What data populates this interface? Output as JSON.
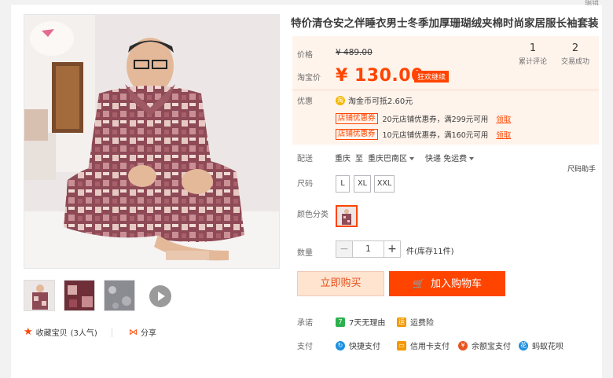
{
  "top": {
    "edit_label": "编辑"
  },
  "product": {
    "title": "特价清仓安之伴睡衣男士冬季加厚珊瑚绒夹棉时尚家居服长袖套装"
  },
  "price": {
    "orig_label": "价格",
    "orig_value": "¥ 489.00",
    "promo_label": "淘宝价",
    "promo_value": "¥ 130.00",
    "promo_tag": "狂欢继续"
  },
  "stats": [
    {
      "number": "1",
      "label": "累计评论"
    },
    {
      "number": "2",
      "label": "交易成功"
    }
  ],
  "promo": {
    "label": "优惠",
    "coin_text": "淘金币可抵2.60元",
    "coupons": [
      {
        "tag": "店铺优惠券",
        "text": "20元店铺优惠券，满299元可用",
        "action": "领取"
      },
      {
        "tag": "店铺优惠券",
        "text": "10元店铺优惠券，满160元可用",
        "action": "领取"
      }
    ]
  },
  "shipping": {
    "label": "配送",
    "from": "重庆",
    "to_word": "至",
    "to": "重庆巴南区",
    "method": "快递 免运费"
  },
  "size": {
    "label": "尺码",
    "helper": "尺码助手",
    "options": [
      "L",
      "XL",
      "XXL"
    ]
  },
  "color": {
    "label": "颜色分类"
  },
  "quantity": {
    "label": "数量",
    "value": "1",
    "minus": "−",
    "plus": "+",
    "stock": "件(库存11件)"
  },
  "actions": {
    "buy_now": "立即购买",
    "add_to_cart": "加入购物车"
  },
  "promise": {
    "label": "承诺",
    "items": [
      {
        "icon": "seven-days-icon",
        "glyph": "7",
        "text": "7天无理由",
        "color": "#2db14e"
      },
      {
        "icon": "shipping-insurance-icon",
        "glyph": "运",
        "text": "运费险",
        "color": "#f39800"
      }
    ]
  },
  "payment": {
    "label": "支付",
    "items": [
      {
        "icon": "quick-pay-icon",
        "glyph": "↻",
        "text": "快捷支付",
        "color": "#1d8fe1"
      },
      {
        "icon": "credit-card-icon",
        "glyph": "▭",
        "text": "信用卡支付",
        "color": "#f39800"
      },
      {
        "icon": "yuebao-icon",
        "glyph": "¥",
        "text": "余额宝支付",
        "color": "#e8541e"
      },
      {
        "icon": "huabei-icon",
        "glyph": "花",
        "text": "蚂蚁花呗",
        "color": "#1d8fe1"
      }
    ]
  },
  "gallery": {
    "favorite": "收藏宝贝",
    "favorite_count": "(3人气)",
    "share": "分享"
  },
  "colors": {
    "accent": "#ff4400",
    "panel_bg": "#fff4ec"
  }
}
